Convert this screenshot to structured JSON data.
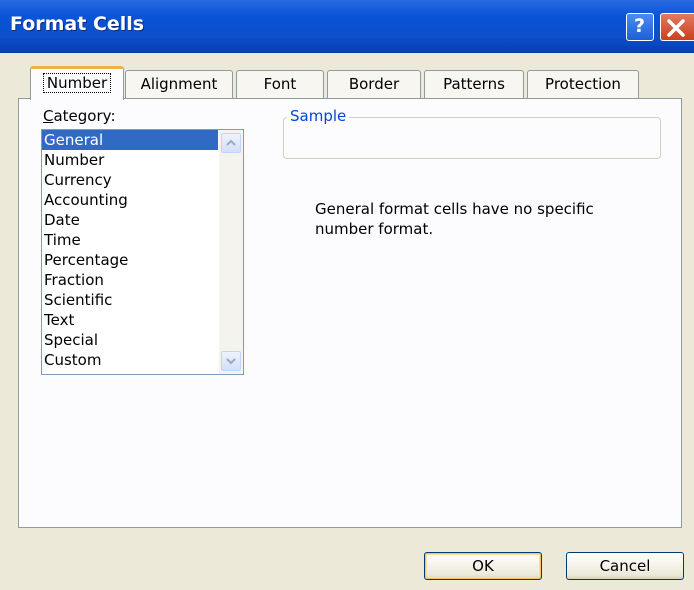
{
  "window": {
    "title": "Format Cells",
    "help_label": "?"
  },
  "tabs": [
    {
      "label": "Number"
    },
    {
      "label": "Alignment"
    },
    {
      "label": "Font"
    },
    {
      "label": "Border"
    },
    {
      "label": "Patterns"
    },
    {
      "label": "Protection"
    }
  ],
  "category": {
    "label_first": "C",
    "label_rest": "ategory:",
    "items": [
      {
        "label": "General"
      },
      {
        "label": "Number"
      },
      {
        "label": "Currency"
      },
      {
        "label": "Accounting"
      },
      {
        "label": "Date"
      },
      {
        "label": "Time"
      },
      {
        "label": "Percentage"
      },
      {
        "label": "Fraction"
      },
      {
        "label": "Scientific"
      },
      {
        "label": "Text"
      },
      {
        "label": "Special"
      },
      {
        "label": "Custom"
      }
    ],
    "selected": "General"
  },
  "sample": {
    "legend": "Sample",
    "value": ""
  },
  "description": "General format cells have no specific number format.",
  "buttons": {
    "ok": "OK",
    "cancel": "Cancel"
  },
  "colors": {
    "title_bar": "#0a54d8",
    "selection": "#316ac5",
    "active_tab_accent": "#f2b24b",
    "sample_legend": "#0046d5"
  }
}
